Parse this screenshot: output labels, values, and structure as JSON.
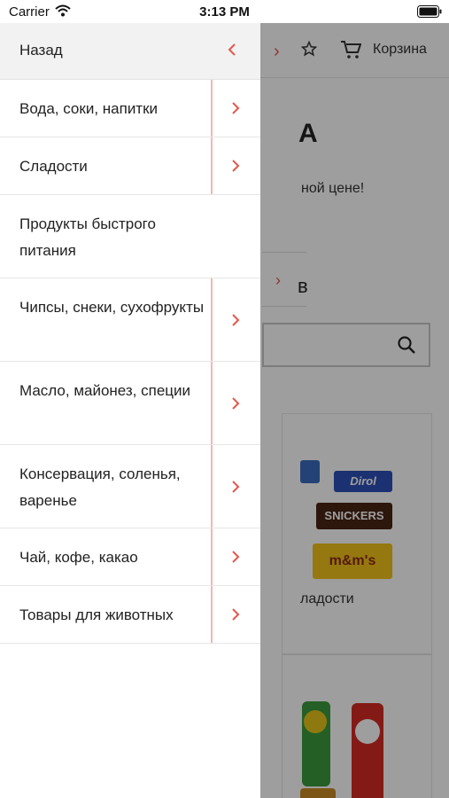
{
  "status_bar": {
    "carrier": "Carrier",
    "time": "3:13 PM"
  },
  "background": {
    "cart_label": "Корзина",
    "logo_fragment": "А",
    "promo_fragment": "ной цене!",
    "catalog_fragment": "в",
    "sweets_card_label": "ладости",
    "product_labels": {
      "dirol": "Dirol",
      "snickers": "SNICKERS",
      "mms": "m&m's"
    }
  },
  "drawer": {
    "back_label": "Назад",
    "accent_color": "#e4574c",
    "items": [
      {
        "label": "Вода, соки, напитки",
        "has_submenu": true
      },
      {
        "label": "Сладости",
        "has_submenu": true
      },
      {
        "label": "Продукты быстрого питания",
        "has_submenu": false
      },
      {
        "label": "Чипсы, снеки, сухофрукты",
        "has_submenu": true
      },
      {
        "label": "Масло, майонез, специи",
        "has_submenu": true
      },
      {
        "label": "Консервация, соленья, варенье",
        "has_submenu": true
      },
      {
        "label": "Чай, кофе, какао",
        "has_submenu": true
      },
      {
        "label": "Товары для животных",
        "has_submenu": true
      }
    ]
  }
}
